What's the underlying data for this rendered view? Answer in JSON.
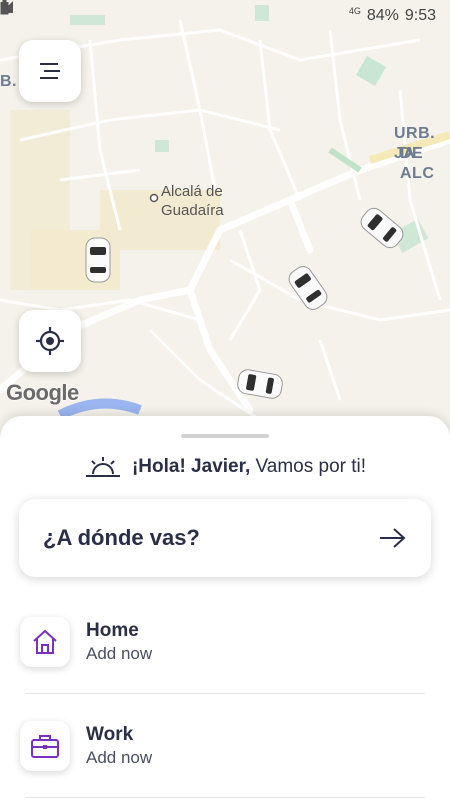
{
  "status_bar": {
    "network": "4G",
    "battery": "84%",
    "time": "9:53"
  },
  "map": {
    "city_label_line1": "Alcalá de",
    "city_label_line2": "Guadaíra",
    "area_left": "B. E.    O",
    "area_right_line1": "URB. JA",
    "area_right_line2": "DE ALC",
    "attribution": "Google"
  },
  "sheet": {
    "greeting_bold": "¡Hola! Javier,",
    "greeting_rest": "Vamos por ti!",
    "where_label": "¿A dónde vas?",
    "places": [
      {
        "title": "Home",
        "subtitle": "Add now",
        "icon": "home-icon"
      },
      {
        "title": "Work",
        "subtitle": "Add now",
        "icon": "briefcase-icon"
      }
    ]
  },
  "colors": {
    "accent": "#7a2fc0",
    "text_dark": "#2b2f45",
    "map_bg": "#f4f2ea"
  }
}
